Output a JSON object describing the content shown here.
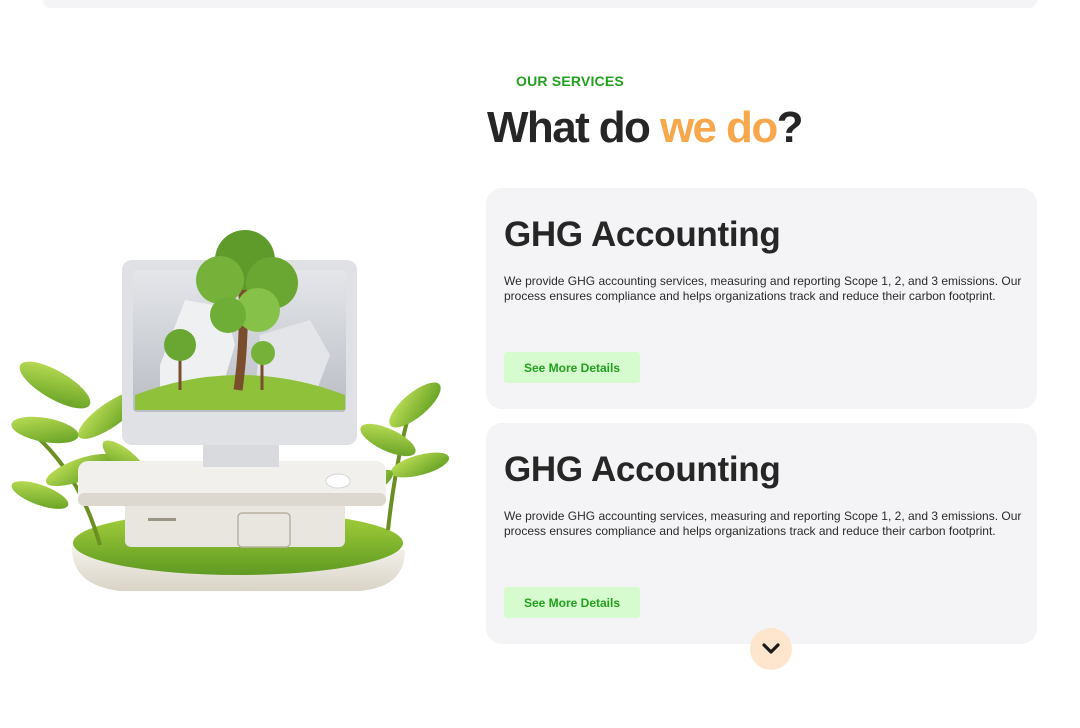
{
  "services": {
    "eyebrow": "OUR SERVICES",
    "headline": {
      "part1": "What do ",
      "accent": "we do",
      "part2": "?"
    },
    "cards": [
      {
        "title": "GHG Accounting",
        "description": "We provide GHG accounting services, measuring and reporting Scope 1, 2, and 3 emissions. Our process ensures compliance and helps organizations track and reduce their carbon footprint.",
        "button_label": "See More Details"
      },
      {
        "title": "GHG Accounting",
        "description": "We provide GHG accounting services, measuring and reporting Scope 1, 2, and 3 emissions. Our process ensures compliance and helps organizations track and reduce their carbon footprint.",
        "button_label": "See More Details"
      }
    ]
  },
  "illustration": {
    "subject": "computer-with-tree-on-moss-island"
  },
  "scroll_button": {
    "icon": "chevron-down-icon"
  },
  "colors": {
    "brand_green": "#22a01e",
    "accent_orange": "#f7a84c",
    "card_bg": "#f4f4f6",
    "button_bg": "#d5fbcf",
    "scroll_bg": "#fde6cd"
  }
}
